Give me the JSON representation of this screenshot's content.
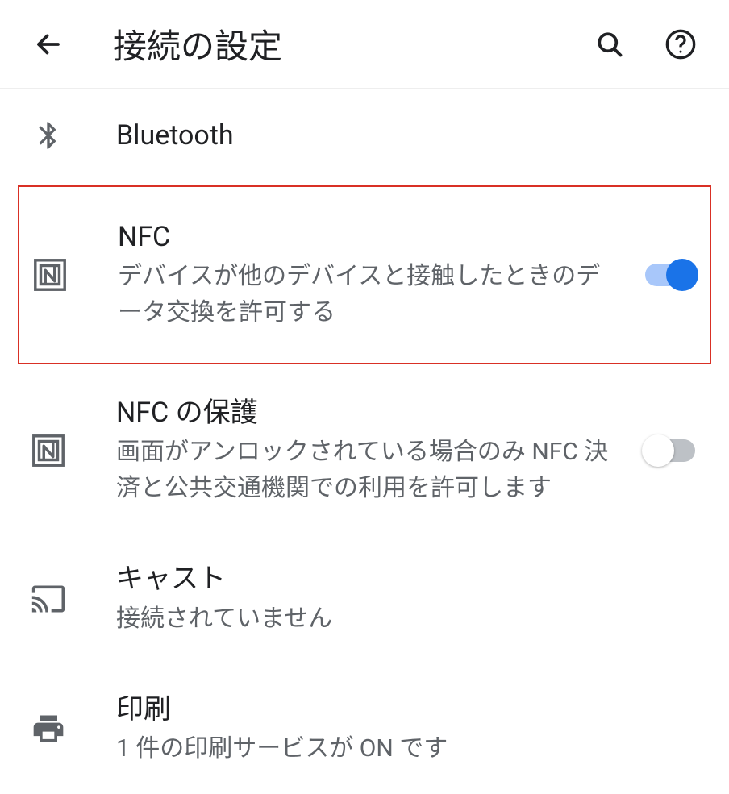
{
  "header": {
    "title": "接続の設定"
  },
  "settings": {
    "bluetooth": {
      "title": "Bluetooth"
    },
    "nfc": {
      "title": "NFC",
      "subtitle": "デバイスが他のデバイスと接触したときのデータ交換を許可する",
      "toggle_on": true
    },
    "nfc_protection": {
      "title": "NFC の保護",
      "subtitle": "画面がアンロックされている場合のみ NFC 決済と公共交通機関での利用を許可します",
      "toggle_on": false
    },
    "cast": {
      "title": "キャスト",
      "subtitle": "接続されていません"
    },
    "print": {
      "title": "印刷",
      "subtitle": "1 件の印刷サービスが ON です"
    }
  }
}
